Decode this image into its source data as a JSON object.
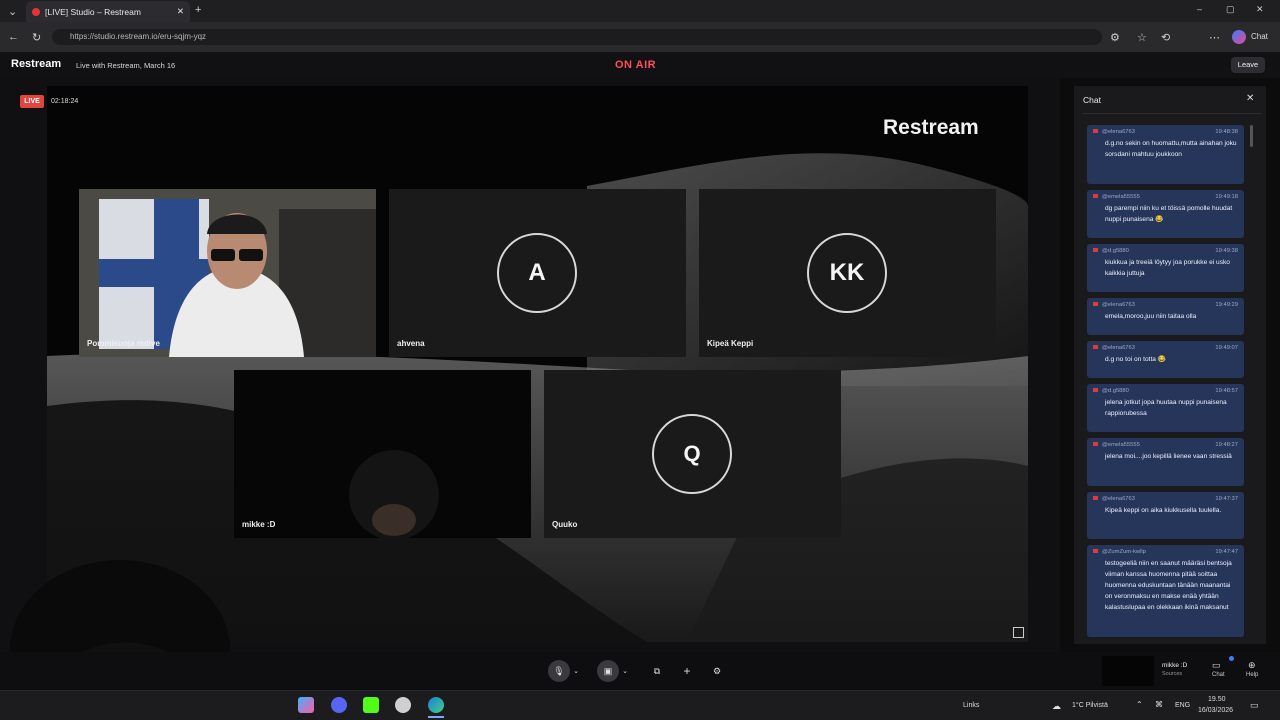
{
  "browser": {
    "tab_title": "[LIVE] Studio – Restream",
    "url": "https://studio.restream.io/eru-sqjm-yqz"
  },
  "header": {
    "logo": "Restream",
    "show_title": "Live with Restream, March 16",
    "on_air": "ON AIR",
    "leave_label": "Leave"
  },
  "stage": {
    "live_badge": "LIVE",
    "timer": "02:18:24",
    "brand": "Restream",
    "participants": [
      {
        "name": "Pommisuoja mdive",
        "initials": ""
      },
      {
        "name": "ahvena",
        "initials": "A"
      },
      {
        "name": "Kipeä Keppi",
        "initials": "KK"
      },
      {
        "name": "mikke :D",
        "initials": ""
      },
      {
        "name": "Quuko",
        "initials": "Q"
      }
    ]
  },
  "chat": {
    "title": "Chat",
    "messages": [
      {
        "user": "@elena6763",
        "time": "19:48:38",
        "text": "d.g.no sekin on huomattu,mutta ainahan joku sorsdani mahtuu joukkoon"
      },
      {
        "user": "@emela55555",
        "time": "19:49:18",
        "text": "dg parempi niin ku et töissä pomolle huudat nuppi punaisena 😂"
      },
      {
        "user": "@d.g5880",
        "time": "19:49:38",
        "text": "kiukkua ja treeiä löytyy joa porukke ei usko kaikkia juttuja"
      },
      {
        "user": "@elena6763",
        "time": "19:49:29",
        "text": "emela,moroo,juu niin taitaa olla"
      },
      {
        "user": "@elena6763",
        "time": "19:49:07",
        "text": "d.g no toi on totta 😂"
      },
      {
        "user": "@d.g5880",
        "time": "19:48:57",
        "text": "jelena jotkut jopa huutaa nuppi punaisena rappiorubessa"
      },
      {
        "user": "@emela55555",
        "time": "19:48:27",
        "text": "jelena moi....joo kepillä lienee vaan stressiä"
      },
      {
        "user": "@elena6763",
        "time": "19:47:37",
        "text": "Kipeä keppi on aika kiukkusella tuulella."
      },
      {
        "user": "@ZumZum-kwllp",
        "time": "19:47:47",
        "text": "testogeeliä niin en saanut määräsi bentsoja viiman kanssa huomenna pitää soittaa huomenna eduskuntaan tänään maanantai on veronmaksu en makse enää yhtään kalastuslupaa en olekkaan ikinä maksanut"
      }
    ]
  },
  "controls": {
    "self_name": "mikke :D",
    "self_sub": "Sources",
    "chat_label": "Chat",
    "help_label": "Help"
  },
  "taskbar": {
    "links_label": "Links",
    "weather": "1°C Pilvistä",
    "lang": "ENG",
    "time": "19.50",
    "date": "16/03/2026"
  }
}
